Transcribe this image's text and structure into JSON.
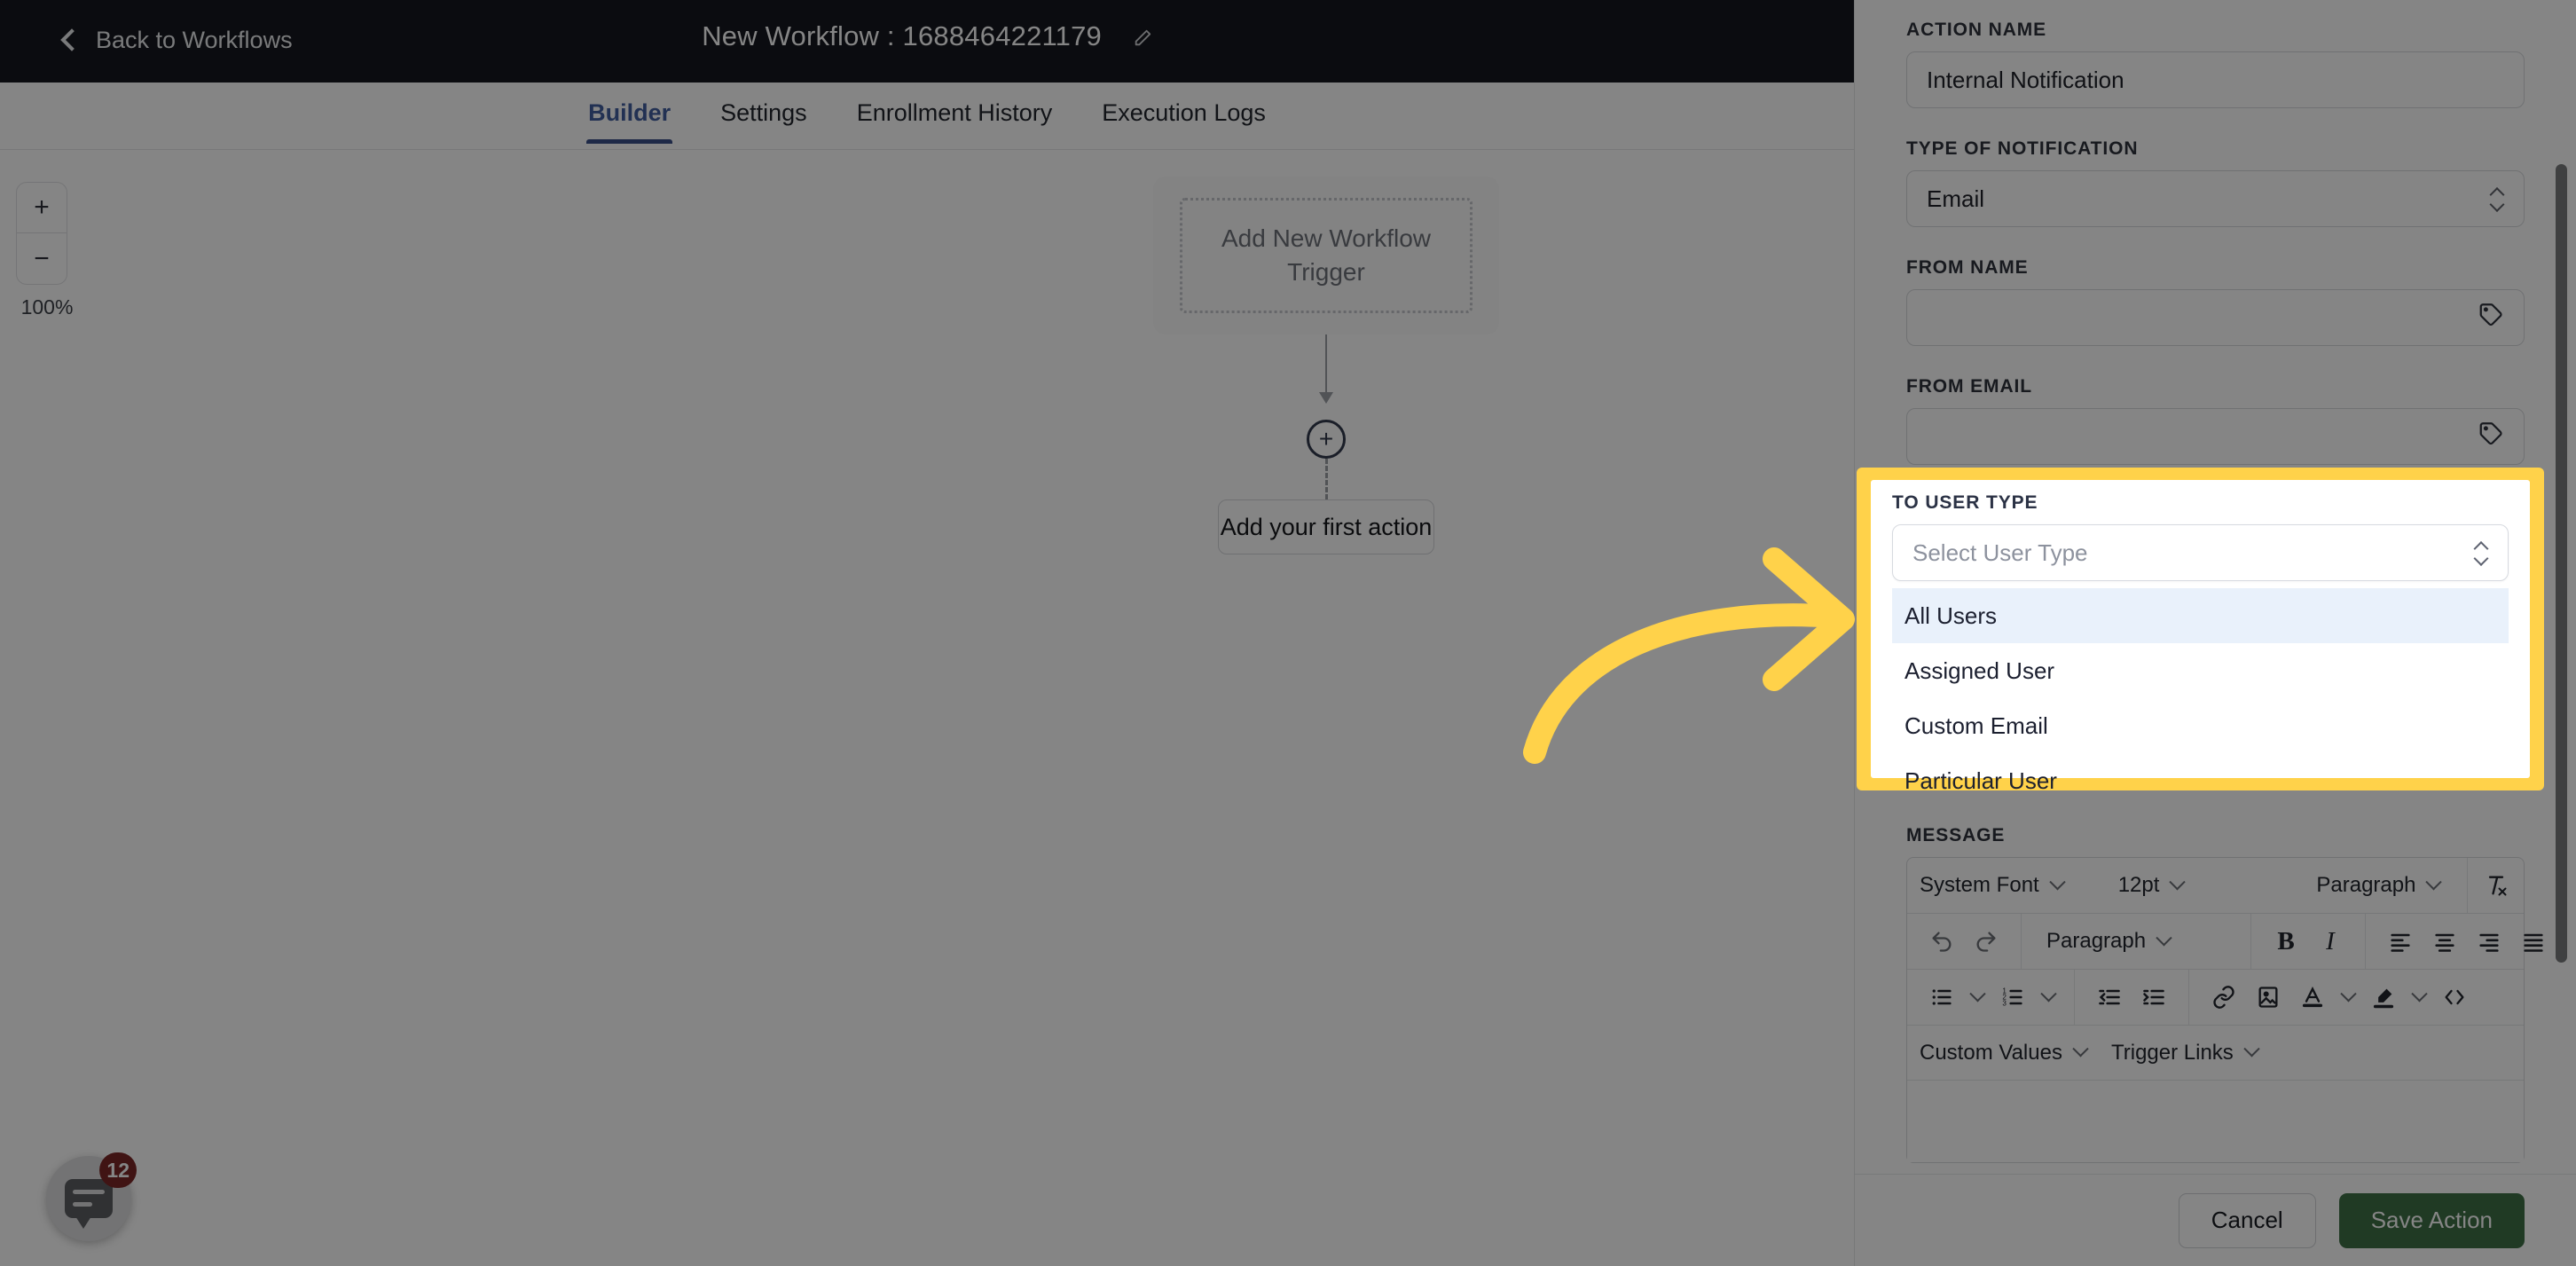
{
  "header": {
    "back_label": "Back to Workflows",
    "back_icon": "chevron-left-icon",
    "title": "New Workflow : 1688464221179",
    "edit_icon": "pencil-icon"
  },
  "tabs": [
    {
      "label": "Builder",
      "active": true
    },
    {
      "label": "Settings",
      "active": false
    },
    {
      "label": "Enrollment History",
      "active": false
    },
    {
      "label": "Execution Logs",
      "active": false
    }
  ],
  "canvas": {
    "zoom": {
      "in_label": "+",
      "out_label": "−",
      "level": "100%"
    },
    "trigger_placeholder": "Add New Workflow Trigger",
    "add_node_label": "+",
    "first_action_label": "Add your first action"
  },
  "chat_widget": {
    "badge": "12",
    "icon": "chat-bubble-icon"
  },
  "panel": {
    "action_name": {
      "label": "ACTION NAME",
      "value": "Internal Notification"
    },
    "type_of_notification": {
      "label": "TYPE OF NOTIFICATION",
      "value": "Email"
    },
    "from_name": {
      "label": "FROM NAME",
      "value": "",
      "icon": "tag-icon"
    },
    "from_email": {
      "label": "FROM EMAIL",
      "value": "",
      "icon": "tag-icon"
    },
    "to_user_type": {
      "label": "TO USER TYPE",
      "placeholder": "Select User Type",
      "value": "",
      "options": [
        "All Users",
        "Assigned User",
        "Custom Email",
        "Particular User"
      ],
      "highlighted_option": "All Users"
    },
    "message": {
      "label": "MESSAGE",
      "toolbar_row1": {
        "font": "System Font",
        "size": "12pt",
        "format": "Paragraph",
        "clear_format_icon": "clear-formatting-icon"
      },
      "toolbar_row2": {
        "undo_icon": "undo-icon",
        "redo_icon": "redo-icon",
        "block": "Paragraph",
        "bold": "B",
        "italic": "I",
        "align_left_icon": "align-left-icon",
        "align_center_icon": "align-center-icon",
        "align_right_icon": "align-right-icon",
        "align_justify_icon": "align-justify-icon"
      },
      "toolbar_row3": {
        "bullet_list_icon": "bullet-list-icon",
        "numbered_list_icon": "numbered-list-icon",
        "outdent_icon": "outdent-icon",
        "indent_icon": "indent-icon",
        "link_icon": "link-icon",
        "image_icon": "image-icon",
        "text_color_icon": "text-color-icon",
        "highlight_icon": "highlight-color-icon",
        "code_icon": "source-code-icon"
      },
      "toolbar_row4": {
        "custom_values": "Custom Values",
        "trigger_links": "Trigger Links"
      },
      "body": ""
    },
    "footer": {
      "cancel_label": "Cancel",
      "save_label": "Save Action"
    }
  },
  "annotation": {
    "arrow_icon": "curved-arrow-right-icon",
    "highlight_color": "#FFD24A"
  }
}
